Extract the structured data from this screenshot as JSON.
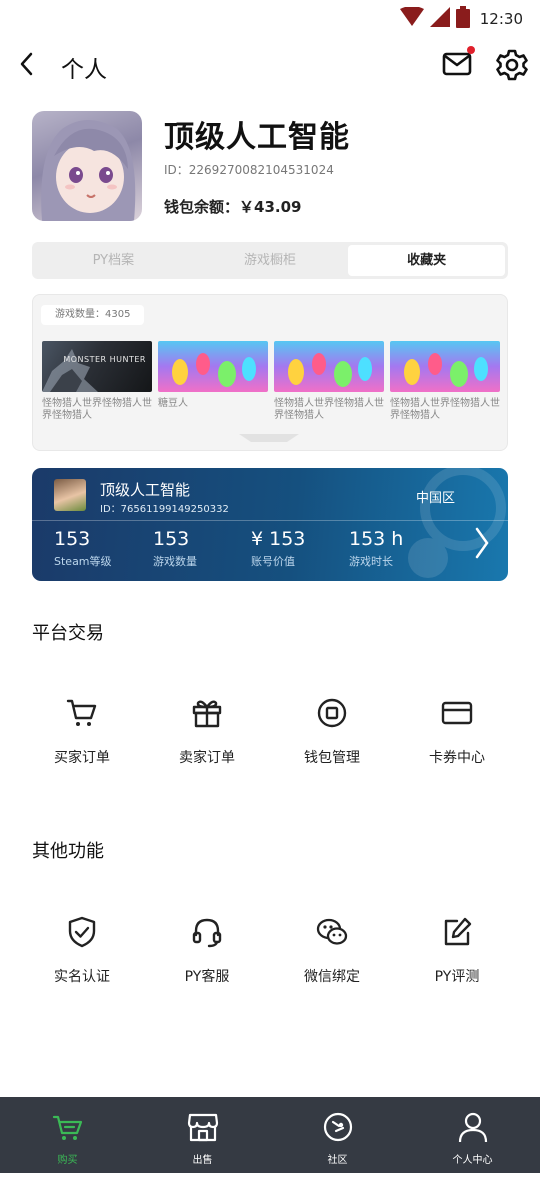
{
  "status_bar": {
    "time": "12:30"
  },
  "header": {
    "title": "个人"
  },
  "profile": {
    "name": "顶级人工智能",
    "id_text": "ID：2269270082104531024",
    "wallet_text": "钱包余额：￥43.09"
  },
  "tabs": [
    {
      "label": "PY档案"
    },
    {
      "label": "游戏橱柜"
    },
    {
      "label": "收藏夹"
    }
  ],
  "games": {
    "count_text": "游戏数量：4305",
    "items": [
      {
        "title": "怪物猎人世界怪物猎人世界怪物猎人",
        "thumb_text": "MONSTER HUNTER"
      },
      {
        "title": "糖豆人"
      },
      {
        "title": "怪物猎人世界怪物猎人世界怪物猎人"
      },
      {
        "title": "怪物猎人世界怪物猎人世界怪物猎人"
      }
    ]
  },
  "steam": {
    "name": "顶级人工智能",
    "id_text": "ID：76561199149250332",
    "region": "中国区",
    "stats": [
      {
        "value": "153",
        "label": "Steam等级"
      },
      {
        "value": "153",
        "label": "游戏数量"
      },
      {
        "value": "¥ 153",
        "label": "账号价值"
      },
      {
        "value": "153 h",
        "label": "游戏时长"
      }
    ]
  },
  "platform": {
    "title": "平台交易",
    "items": [
      {
        "label": "买家订单",
        "icon": "cart-icon"
      },
      {
        "label": "卖家订单",
        "icon": "gift-icon"
      },
      {
        "label": "钱包管理",
        "icon": "wallet-icon"
      },
      {
        "label": "卡券中心",
        "icon": "card-icon"
      }
    ]
  },
  "other": {
    "title": "其他功能",
    "items": [
      {
        "label": "实名认证",
        "icon": "shield-check-icon"
      },
      {
        "label": "PY客服",
        "icon": "headset-icon"
      },
      {
        "label": "微信绑定",
        "icon": "wechat-icon"
      },
      {
        "label": "PY评测",
        "icon": "edit-icon"
      }
    ]
  },
  "nav": [
    {
      "label": "购买",
      "icon": "cart-icon",
      "active": true
    },
    {
      "label": "出售",
      "icon": "store-icon",
      "active": false
    },
    {
      "label": "社区",
      "icon": "steam-logo-icon",
      "active": false
    },
    {
      "label": "个人中心",
      "icon": "person-icon",
      "active": false
    }
  ],
  "colors": {
    "accent_green": "#3bba56",
    "nav_bg": "#353a43",
    "steam_blue": "#15507f",
    "badge_red": "#e0202b"
  }
}
